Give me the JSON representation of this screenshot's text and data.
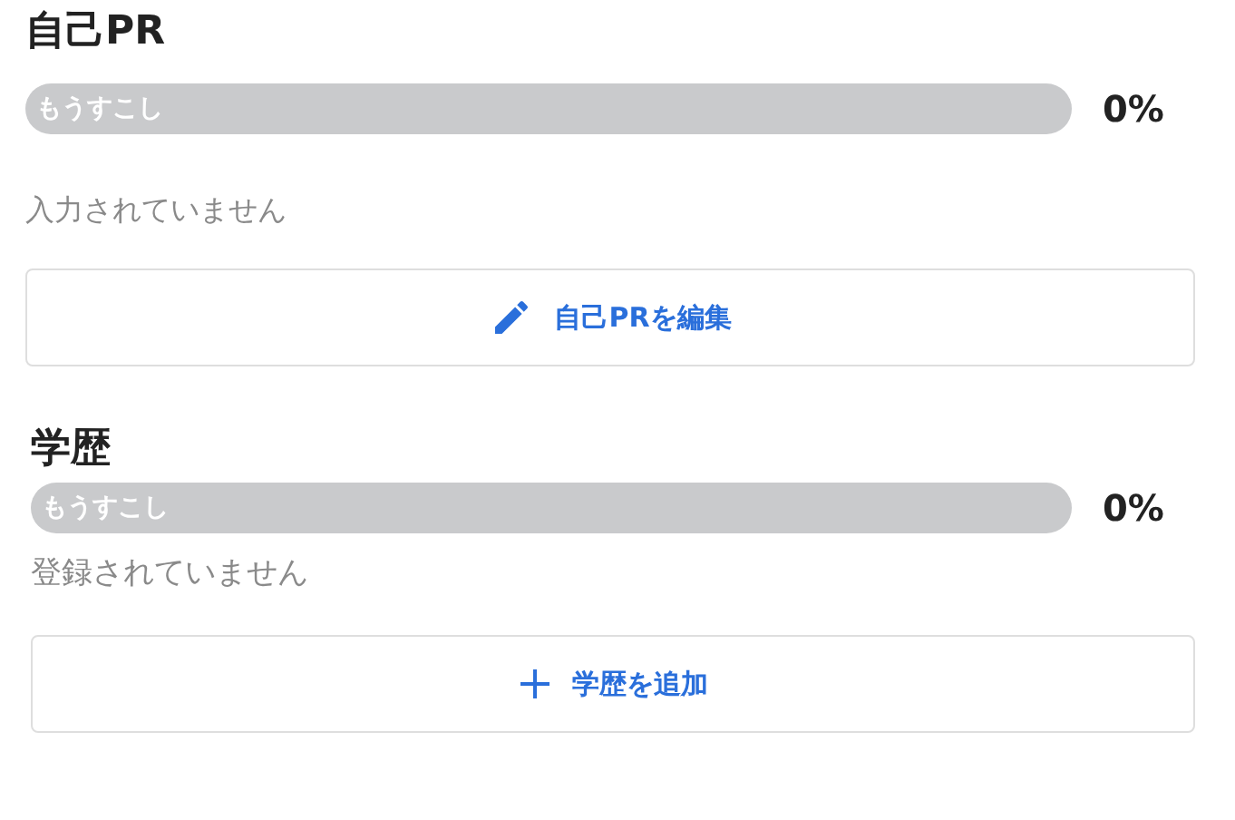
{
  "sections": [
    {
      "title": "自己PR",
      "progress": {
        "label": "もうすこし",
        "level": 0,
        "reading": "0%"
      },
      "empty_text": "入力されていません",
      "button": {
        "kind": "edit",
        "label": "自己PRを編集"
      }
    },
    {
      "title": "学歴",
      "progress": {
        "label": "もうすこし",
        "level": 0,
        "reading": "0%"
      },
      "empty_text": "登録されていません",
      "button": {
        "kind": "add",
        "label": "学歴を追加"
      }
    }
  ]
}
